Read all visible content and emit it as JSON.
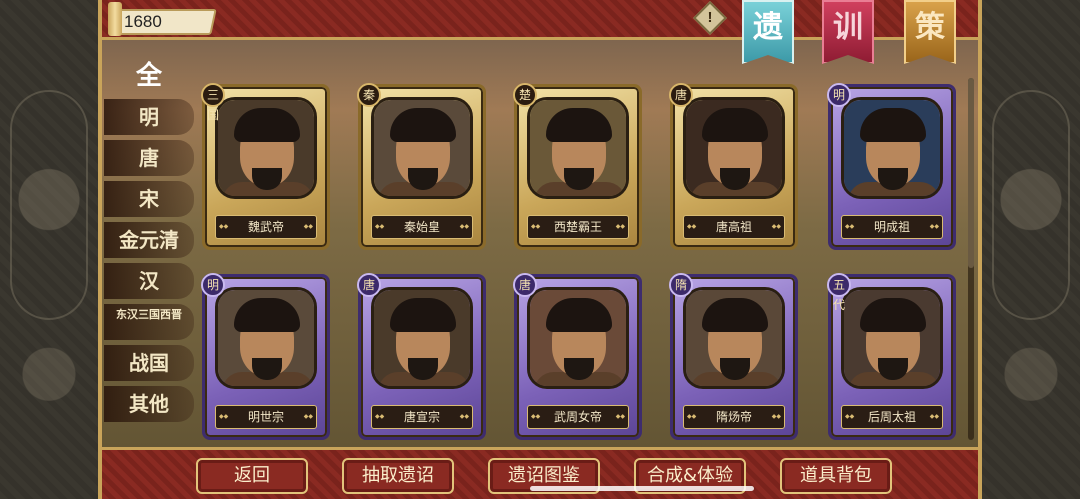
{
  "currency": {
    "value": "1680"
  },
  "alert_icon": "!",
  "banners": [
    "遗",
    "训",
    "策"
  ],
  "categories": [
    "全",
    "明",
    "唐",
    "宋",
    "金元清",
    "汉",
    "东汉三国西晋",
    "战国",
    "其他"
  ],
  "cards": [
    {
      "name": "魏武帝",
      "dynasty": "三国",
      "frame": "gold"
    },
    {
      "name": "秦始皇",
      "dynasty": "秦",
      "frame": "gold"
    },
    {
      "name": "西楚霸王",
      "dynasty": "楚",
      "frame": "gold"
    },
    {
      "name": "唐高祖",
      "dynasty": "唐",
      "frame": "gold"
    },
    {
      "name": "明成祖",
      "dynasty": "明",
      "frame": "purple"
    },
    {
      "name": "明世宗",
      "dynasty": "明",
      "frame": "purple"
    },
    {
      "name": "唐宣宗",
      "dynasty": "唐",
      "frame": "purple"
    },
    {
      "name": "武周女帝",
      "dynasty": "唐",
      "frame": "purple"
    },
    {
      "name": "隋炀帝",
      "dynasty": "隋",
      "frame": "purple"
    },
    {
      "name": "后周太祖",
      "dynasty": "五代",
      "frame": "purple"
    }
  ],
  "buttons": {
    "back": "返回",
    "draw": "抽取遗诏",
    "gallery": "遗诏图鉴",
    "synth": "合成&体验",
    "bag": "道具背包"
  }
}
